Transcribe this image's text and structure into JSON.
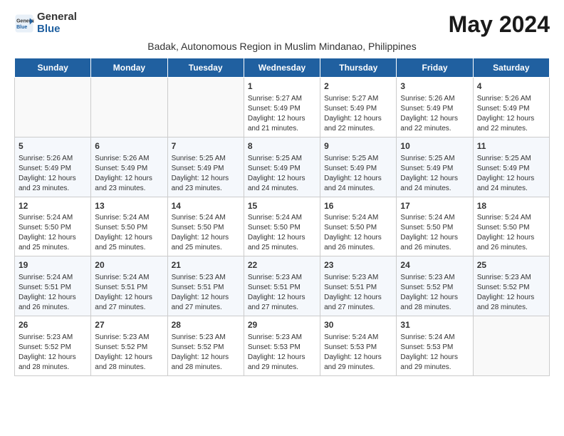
{
  "header": {
    "logo_general": "General",
    "logo_blue": "Blue",
    "month_title": "May 2024",
    "subtitle": "Badak, Autonomous Region in Muslim Mindanao, Philippines"
  },
  "days_of_week": [
    "Sunday",
    "Monday",
    "Tuesday",
    "Wednesday",
    "Thursday",
    "Friday",
    "Saturday"
  ],
  "weeks": [
    [
      {
        "day": "",
        "info": ""
      },
      {
        "day": "",
        "info": ""
      },
      {
        "day": "",
        "info": ""
      },
      {
        "day": "1",
        "info": "Sunrise: 5:27 AM\nSunset: 5:49 PM\nDaylight: 12 hours\nand 21 minutes."
      },
      {
        "day": "2",
        "info": "Sunrise: 5:27 AM\nSunset: 5:49 PM\nDaylight: 12 hours\nand 22 minutes."
      },
      {
        "day": "3",
        "info": "Sunrise: 5:26 AM\nSunset: 5:49 PM\nDaylight: 12 hours\nand 22 minutes."
      },
      {
        "day": "4",
        "info": "Sunrise: 5:26 AM\nSunset: 5:49 PM\nDaylight: 12 hours\nand 22 minutes."
      }
    ],
    [
      {
        "day": "5",
        "info": "Sunrise: 5:26 AM\nSunset: 5:49 PM\nDaylight: 12 hours\nand 23 minutes."
      },
      {
        "day": "6",
        "info": "Sunrise: 5:26 AM\nSunset: 5:49 PM\nDaylight: 12 hours\nand 23 minutes."
      },
      {
        "day": "7",
        "info": "Sunrise: 5:25 AM\nSunset: 5:49 PM\nDaylight: 12 hours\nand 23 minutes."
      },
      {
        "day": "8",
        "info": "Sunrise: 5:25 AM\nSunset: 5:49 PM\nDaylight: 12 hours\nand 24 minutes."
      },
      {
        "day": "9",
        "info": "Sunrise: 5:25 AM\nSunset: 5:49 PM\nDaylight: 12 hours\nand 24 minutes."
      },
      {
        "day": "10",
        "info": "Sunrise: 5:25 AM\nSunset: 5:49 PM\nDaylight: 12 hours\nand 24 minutes."
      },
      {
        "day": "11",
        "info": "Sunrise: 5:25 AM\nSunset: 5:49 PM\nDaylight: 12 hours\nand 24 minutes."
      }
    ],
    [
      {
        "day": "12",
        "info": "Sunrise: 5:24 AM\nSunset: 5:50 PM\nDaylight: 12 hours\nand 25 minutes."
      },
      {
        "day": "13",
        "info": "Sunrise: 5:24 AM\nSunset: 5:50 PM\nDaylight: 12 hours\nand 25 minutes."
      },
      {
        "day": "14",
        "info": "Sunrise: 5:24 AM\nSunset: 5:50 PM\nDaylight: 12 hours\nand 25 minutes."
      },
      {
        "day": "15",
        "info": "Sunrise: 5:24 AM\nSunset: 5:50 PM\nDaylight: 12 hours\nand 25 minutes."
      },
      {
        "day": "16",
        "info": "Sunrise: 5:24 AM\nSunset: 5:50 PM\nDaylight: 12 hours\nand 26 minutes."
      },
      {
        "day": "17",
        "info": "Sunrise: 5:24 AM\nSunset: 5:50 PM\nDaylight: 12 hours\nand 26 minutes."
      },
      {
        "day": "18",
        "info": "Sunrise: 5:24 AM\nSunset: 5:50 PM\nDaylight: 12 hours\nand 26 minutes."
      }
    ],
    [
      {
        "day": "19",
        "info": "Sunrise: 5:24 AM\nSunset: 5:51 PM\nDaylight: 12 hours\nand 26 minutes."
      },
      {
        "day": "20",
        "info": "Sunrise: 5:24 AM\nSunset: 5:51 PM\nDaylight: 12 hours\nand 27 minutes."
      },
      {
        "day": "21",
        "info": "Sunrise: 5:23 AM\nSunset: 5:51 PM\nDaylight: 12 hours\nand 27 minutes."
      },
      {
        "day": "22",
        "info": "Sunrise: 5:23 AM\nSunset: 5:51 PM\nDaylight: 12 hours\nand 27 minutes."
      },
      {
        "day": "23",
        "info": "Sunrise: 5:23 AM\nSunset: 5:51 PM\nDaylight: 12 hours\nand 27 minutes."
      },
      {
        "day": "24",
        "info": "Sunrise: 5:23 AM\nSunset: 5:52 PM\nDaylight: 12 hours\nand 28 minutes."
      },
      {
        "day": "25",
        "info": "Sunrise: 5:23 AM\nSunset: 5:52 PM\nDaylight: 12 hours\nand 28 minutes."
      }
    ],
    [
      {
        "day": "26",
        "info": "Sunrise: 5:23 AM\nSunset: 5:52 PM\nDaylight: 12 hours\nand 28 minutes."
      },
      {
        "day": "27",
        "info": "Sunrise: 5:23 AM\nSunset: 5:52 PM\nDaylight: 12 hours\nand 28 minutes."
      },
      {
        "day": "28",
        "info": "Sunrise: 5:23 AM\nSunset: 5:52 PM\nDaylight: 12 hours\nand 28 minutes."
      },
      {
        "day": "29",
        "info": "Sunrise: 5:23 AM\nSunset: 5:53 PM\nDaylight: 12 hours\nand 29 minutes."
      },
      {
        "day": "30",
        "info": "Sunrise: 5:24 AM\nSunset: 5:53 PM\nDaylight: 12 hours\nand 29 minutes."
      },
      {
        "day": "31",
        "info": "Sunrise: 5:24 AM\nSunset: 5:53 PM\nDaylight: 12 hours\nand 29 minutes."
      },
      {
        "day": "",
        "info": ""
      }
    ]
  ]
}
